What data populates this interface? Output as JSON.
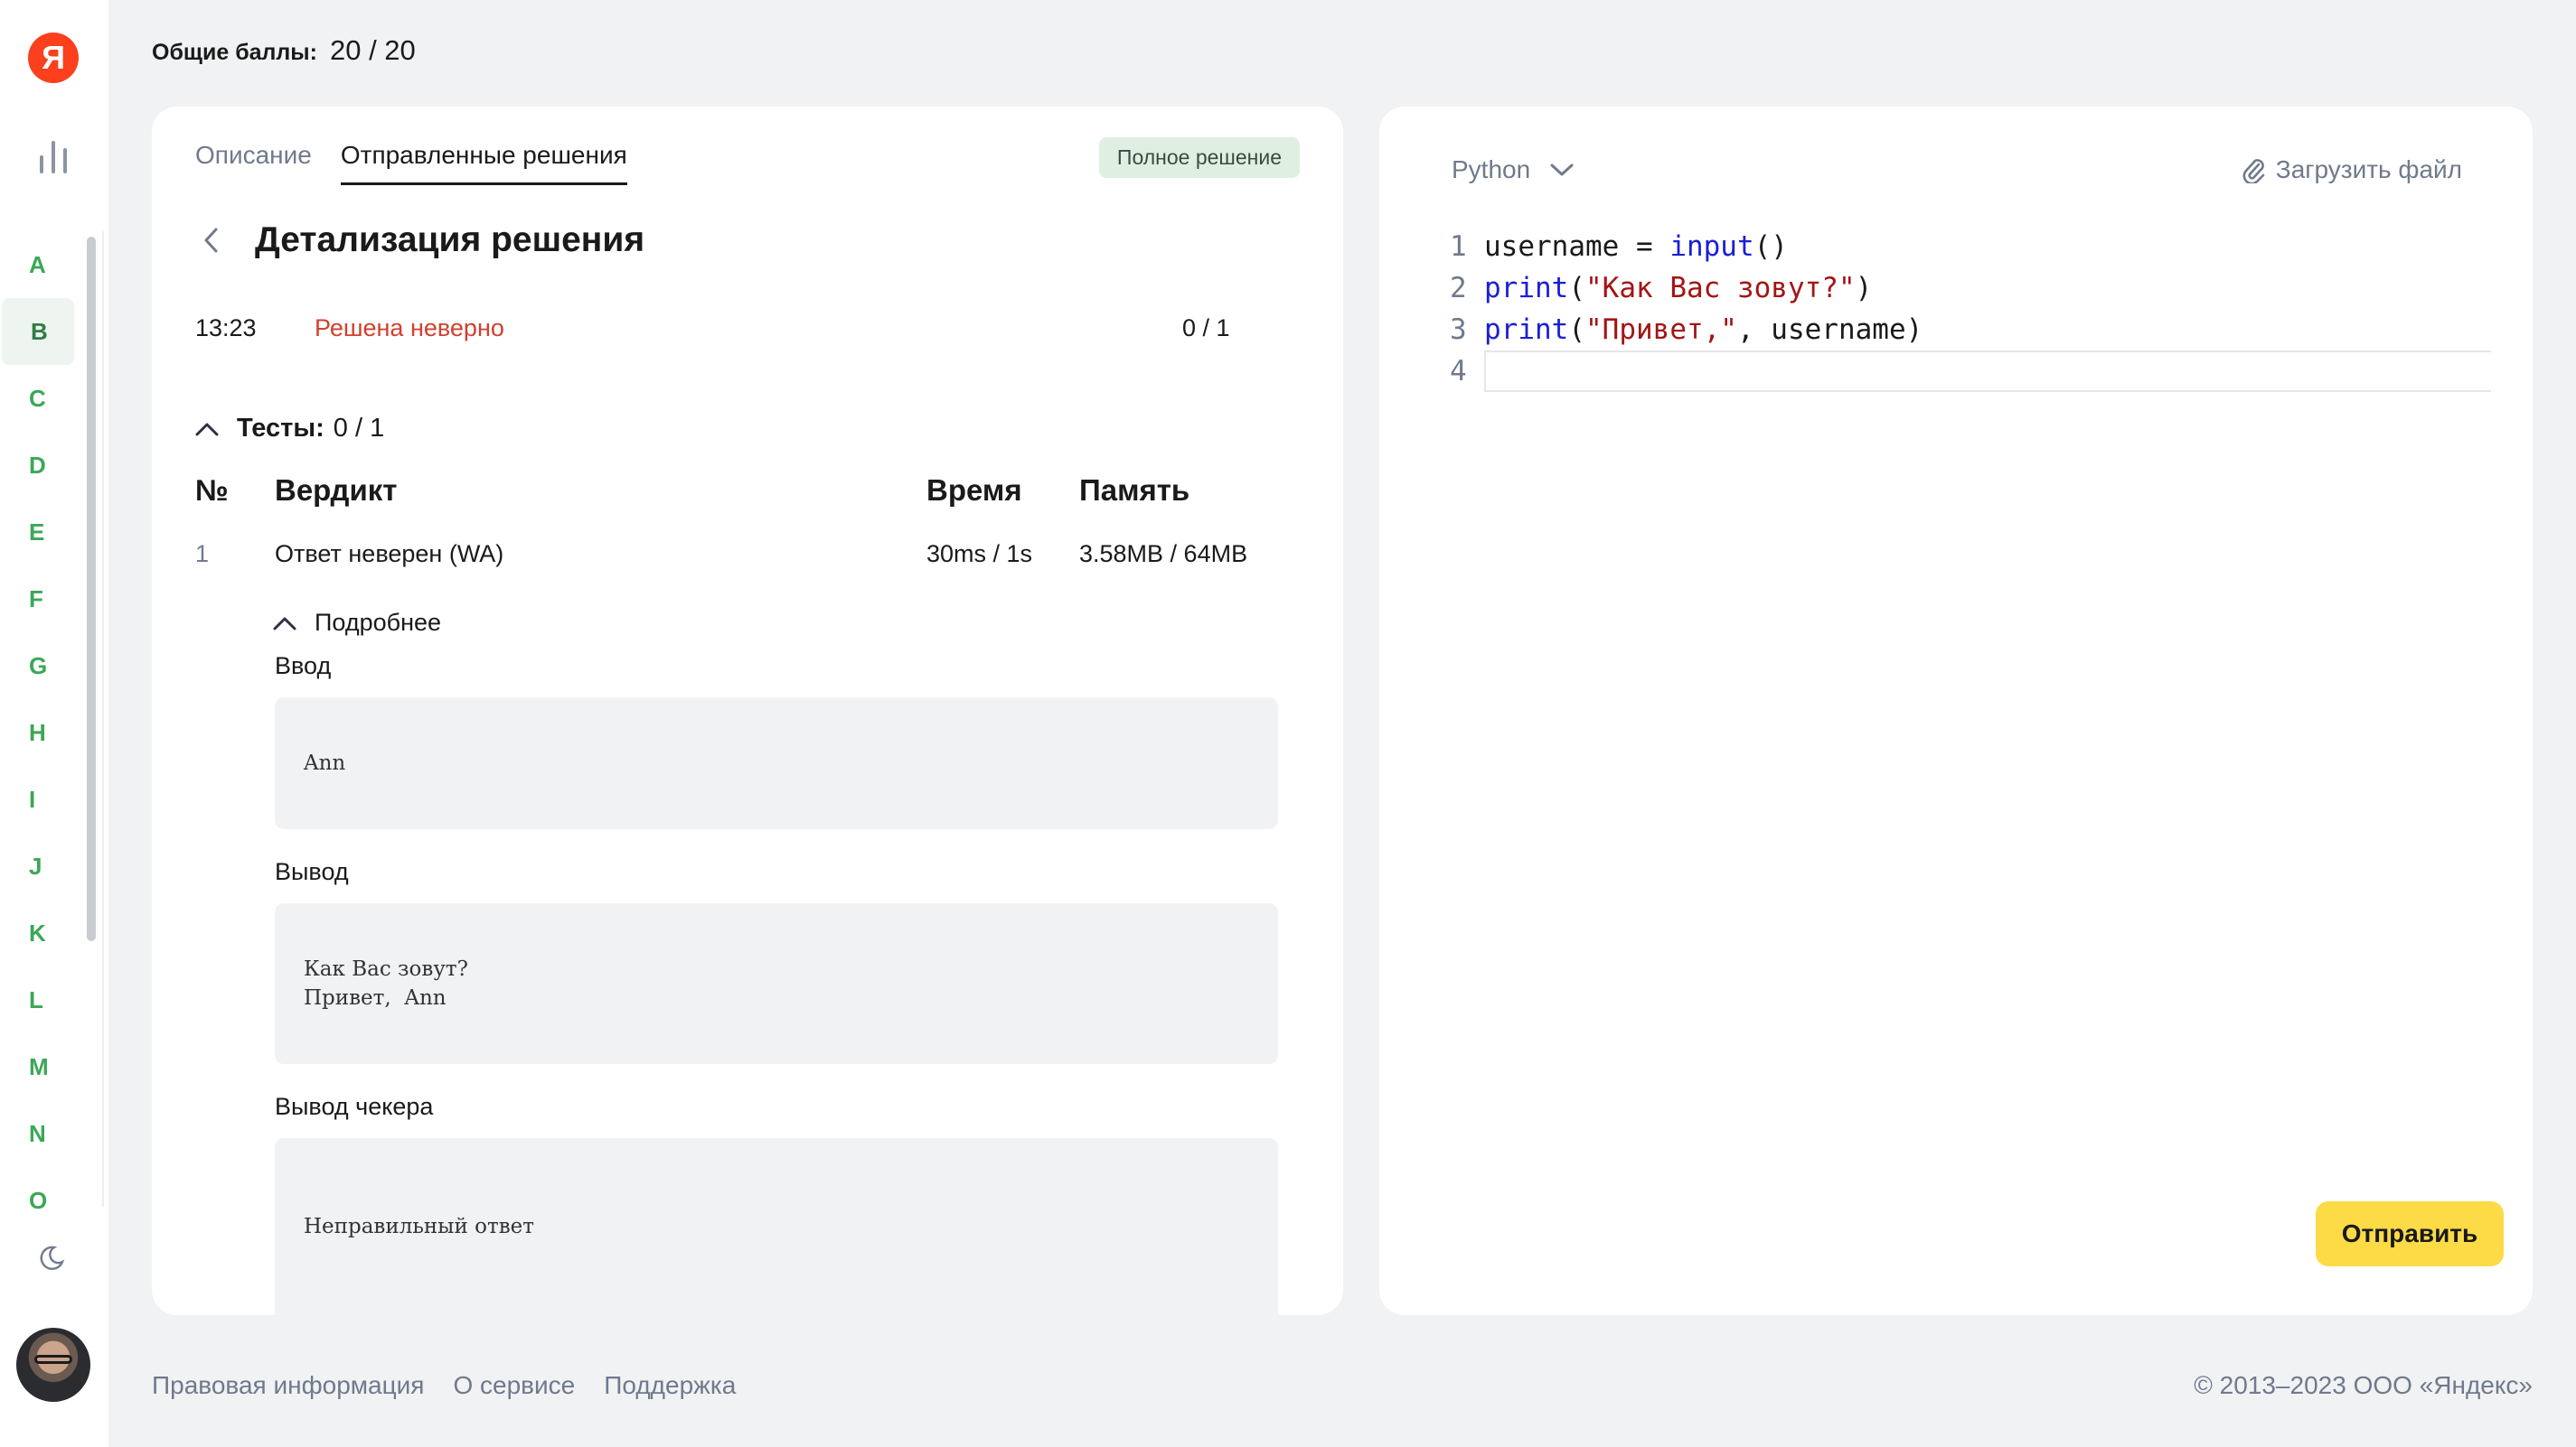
{
  "rail": {
    "logo_letter": "Я",
    "letters": [
      "A",
      "B",
      "C",
      "D",
      "E",
      "F",
      "G",
      "H",
      "I",
      "J",
      "K",
      "L",
      "M",
      "N",
      "O"
    ],
    "active_letter": "B"
  },
  "header": {
    "score_label": "Общие баллы:",
    "score_value": "20 / 20"
  },
  "left_panel": {
    "tabs": [
      {
        "label": "Описание",
        "active": false
      },
      {
        "label": "Отправленные решения",
        "active": true
      }
    ],
    "badge": "Полное решение",
    "title": "Детализация решения",
    "attempt": {
      "time": "13:23",
      "status": "Решена неверно",
      "score": "0 / 1"
    },
    "tests_label": "Тесты:",
    "tests_value": "0 / 1",
    "table": {
      "headers": [
        "№",
        "Вердикт",
        "Время",
        "Память"
      ],
      "row": {
        "num": "1",
        "verdict": "Ответ неверен (WA)",
        "time": "30ms / 1s",
        "memory": "3.58MB / 64MB"
      }
    },
    "more_label": "Подробнее",
    "input_label": "Ввод",
    "input_text": "Ann",
    "output_label": "Вывод",
    "output_text": "Как Вас зовут?\nПривет,  Ann",
    "checker_label": "Вывод чекера",
    "checker_text": "Неправильный ответ"
  },
  "editor": {
    "language": "Python",
    "upload_label": "Загрузить файл",
    "line_numbers": [
      "1",
      "2",
      "3",
      "4"
    ],
    "submit_label": "Отправить",
    "colors": {
      "keyword": "#1a1fd6",
      "string": "#a31515"
    }
  },
  "footer": {
    "links": [
      "Правовая информация",
      "О сервисе",
      "Поддержка"
    ],
    "copyright": "© 2013–2023 ООО «Яндекс»"
  },
  "colors": {
    "accent_green": "#3aa856",
    "error_red": "#d1402f",
    "submit_yellow": "#fcdb46",
    "badge_green": "#dff0e3"
  }
}
